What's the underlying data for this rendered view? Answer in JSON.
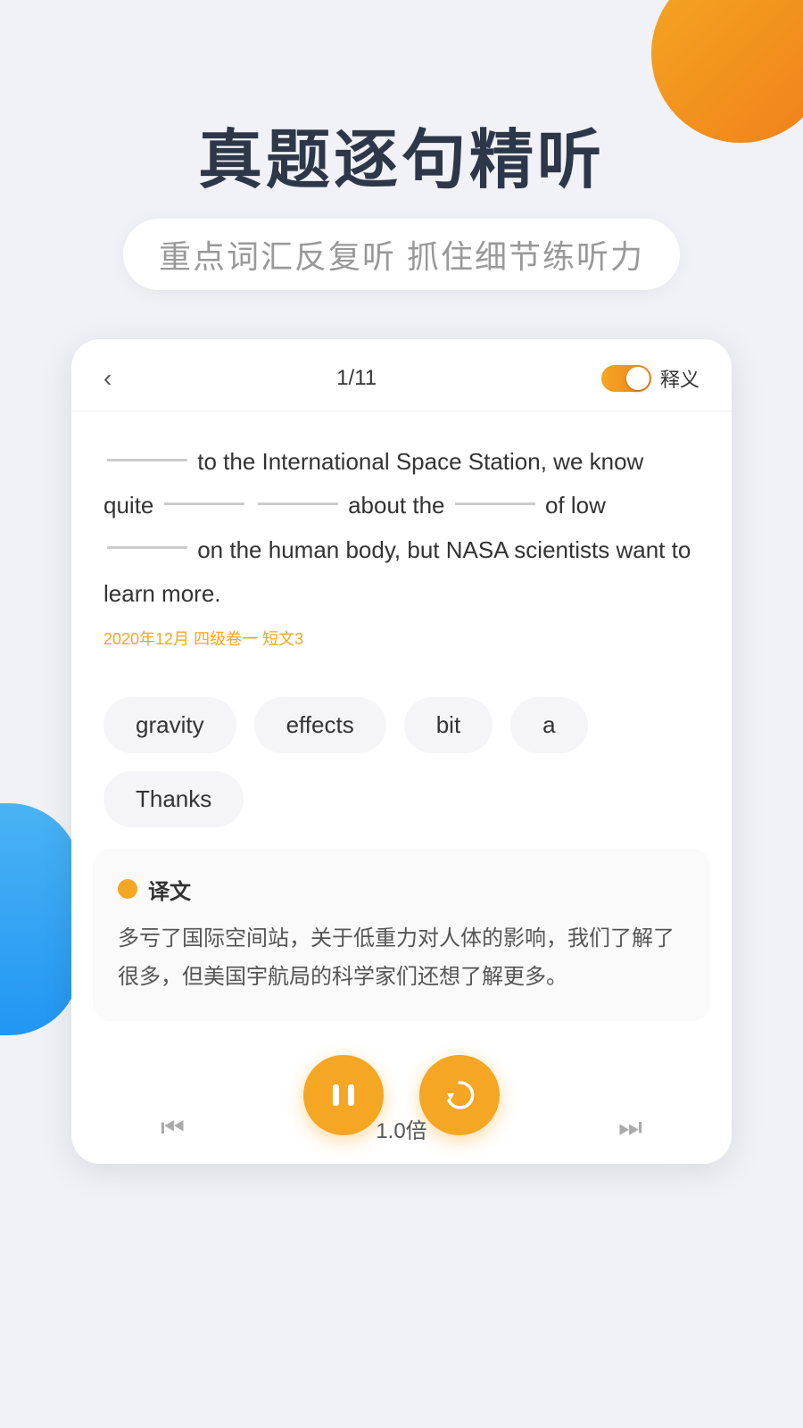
{
  "page": {
    "background_color": "#f0f2f7"
  },
  "header": {
    "main_title": "真题逐句精听",
    "subtitle": "重点词汇反复听  抓住细节练听力"
  },
  "card": {
    "back_icon": "‹",
    "page_indicator": "1/11",
    "toggle_label": "释义",
    "sentence": "________ to the International Space Station, we know quite ________ ________ about the ________ of low ________ on the human body, but NASA scientists want to learn more.",
    "source": "2020年12月 四级卷一 短文3",
    "chips": [
      "gravity",
      "effects",
      "bit",
      "a",
      "Thanks"
    ],
    "translation": {
      "icon_label": "译文",
      "text": "多亏了国际空间站，关于低重力对人体的影响，我们了解了很多，但美国宇航局的科学家们还想了解更多。"
    },
    "controls": {
      "play_pause_icon": "pause",
      "refresh_icon": "refresh"
    },
    "footer": {
      "prev_icon": "⏮",
      "speed": "1.0倍",
      "next_icon": "⏭"
    }
  }
}
